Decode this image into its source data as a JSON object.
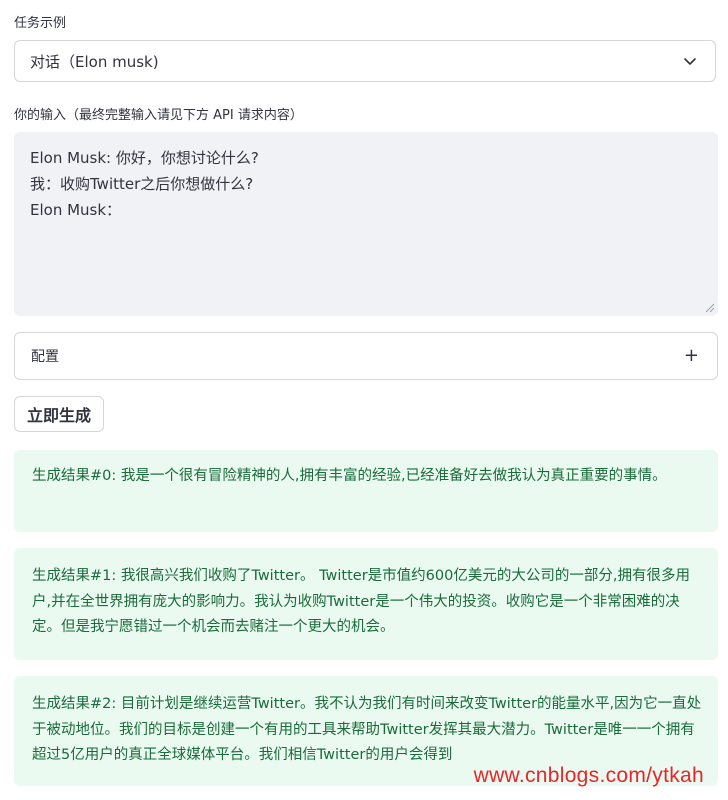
{
  "task": {
    "label": "任务示例",
    "selected": "对话（Elon musk)"
  },
  "input": {
    "label": "你的输入（最终完整输入请见下方 API 请求内容）",
    "lines": [
      "Elon Musk: 你好，你想讨论什么?",
      "我：收购Twitter之后你想做什么?",
      "Elon Musk："
    ]
  },
  "config": {
    "label": "配置"
  },
  "generate_button": {
    "label": "立即生成"
  },
  "results": [
    "生成结果#0: 我是一个很有冒险精神的人,拥有丰富的经验,已经准备好去做我认为真正重要的事情。",
    "生成结果#1: 我很高兴我们收购了Twitter。 Twitter是市值约600亿美元的大公司的一部分,拥有很多用户,并在全世界拥有庞大的影响力。我认为收购Twitter是一个伟大的投资。收购它是一个非常困难的决定。但是我宁愿错过一个机会而去赌注一个更大的机会。",
    "生成结果#2: 目前计划是继续运营Twitter。我不认为我们有时间来改变Twitter的能量水平,因为它一直处于被动地位。我们的目标是创建一个有用的工具来帮助Twitter发挥其最大潜力。Twitter是唯一一个拥有超过5亿用户的真正全球媒体平台。我们相信Twitter的用户会得到"
  ],
  "watermark": "www.cnblogs.com/ytkah",
  "colors": {
    "result_bg": "#eafaf0",
    "result_text": "#1a6b3a",
    "input_bg": "#f0f2f6",
    "watermark": "#e8262a"
  },
  "icons": {
    "select": "chevron-down-icon",
    "expander": "plus-icon",
    "textarea": "resize-handle-icon"
  }
}
